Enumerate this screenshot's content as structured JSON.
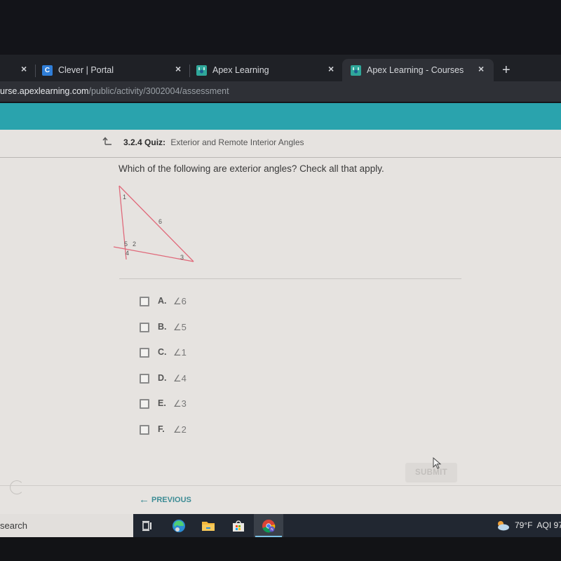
{
  "browser": {
    "tabs": [
      {
        "label": "",
        "favicon": "",
        "active": false
      },
      {
        "label": "Clever | Portal",
        "favicon": "clever-icon",
        "favicon_glyph": "C",
        "active": false
      },
      {
        "label": "Apex Learning",
        "favicon": "apex-learning-icon",
        "active": false
      },
      {
        "label": "Apex Learning - Courses",
        "favicon": "apex-learning-icon",
        "active": true
      }
    ],
    "close_glyph": "×",
    "new_tab_glyph": "+",
    "url_host": "urse.apexlearning.com",
    "url_path": "/public/activity/3002004/assessment"
  },
  "quiz": {
    "number": "3.2.4",
    "kind": "Quiz:",
    "title": "Exterior and Remote Interior Angles",
    "question": "Which of the following are exterior angles? Check all that apply.",
    "diagram_labels": {
      "a1": "1",
      "a2": "2",
      "a3": "3",
      "a4": "4",
      "a5": "5",
      "a6": "6"
    },
    "options": [
      {
        "letter": "A.",
        "value": "∠6",
        "checked": false
      },
      {
        "letter": "B.",
        "value": "∠5",
        "checked": false
      },
      {
        "letter": "C.",
        "value": "∠1",
        "checked": false
      },
      {
        "letter": "D.",
        "value": "∠4",
        "checked": false
      },
      {
        "letter": "E.",
        "value": "∠3",
        "checked": false
      },
      {
        "letter": "F.",
        "value": "∠2",
        "checked": false
      }
    ],
    "submit_label": "SUBMIT",
    "previous_label": "PREVIOUS",
    "previous_arrow": "←"
  },
  "taskbar": {
    "search_text": "search",
    "apps": [
      "task-view-icon",
      "edge-icon",
      "file-explorer-icon",
      "microsoft-store-icon",
      "chrome-icon"
    ],
    "weather": "79°F",
    "aqi": "AQI 97"
  },
  "colors": {
    "teal_band": "#2aa3ad",
    "link": "#3d8c95",
    "diagram_line": "#e0697a"
  }
}
